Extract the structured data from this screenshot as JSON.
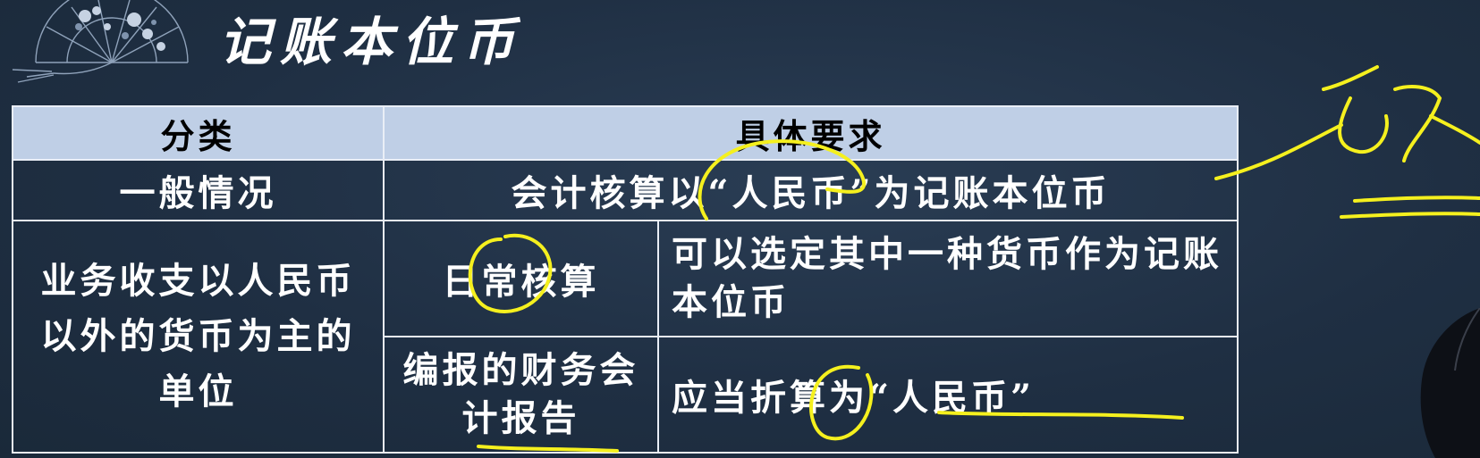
{
  "slide": {
    "title": "记账本位币"
  },
  "table": {
    "headers": {
      "category": "分类",
      "requirement": "具体要求"
    },
    "row_general": {
      "category": "一般情况",
      "requirement": "会计核算以“人民币”为记账本位币"
    },
    "row_foreign": {
      "category": "业务收支以人民币以外的货币为主的单位",
      "sub_daily": {
        "label": "日常核算",
        "requirement": "可以选定其中一种货币作为记账本位币"
      },
      "sub_report": {
        "label": "编报的财务会计报告",
        "requirement": "应当折算为“人民币”"
      }
    }
  },
  "colors": {
    "background": "#213246",
    "header_fill": "#bfcfe6",
    "grid_line": "#e9eef6",
    "annotation": "#f5f01e"
  },
  "icons": {
    "decoration": "folding-fan-icon"
  }
}
